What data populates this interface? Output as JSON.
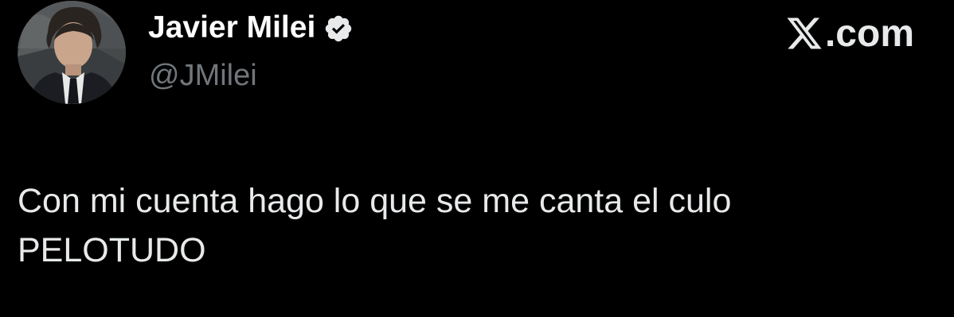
{
  "author": {
    "display_name": "Javier Milei",
    "handle": "@JMilei",
    "verified": true,
    "avatar_icon": "profile-photo"
  },
  "brand": {
    "logo_icon": "x-logo-icon",
    "domain": ".com"
  },
  "tweet": {
    "lines": [
      "Con mi cuenta hago lo que se me canta el culo",
      "PELOTUDO"
    ]
  },
  "colors": {
    "background": "#000000",
    "name": "#ffffff",
    "handle": "#71767b",
    "text": "#e7e9ea",
    "verified_badge": "#e7e9ea"
  }
}
